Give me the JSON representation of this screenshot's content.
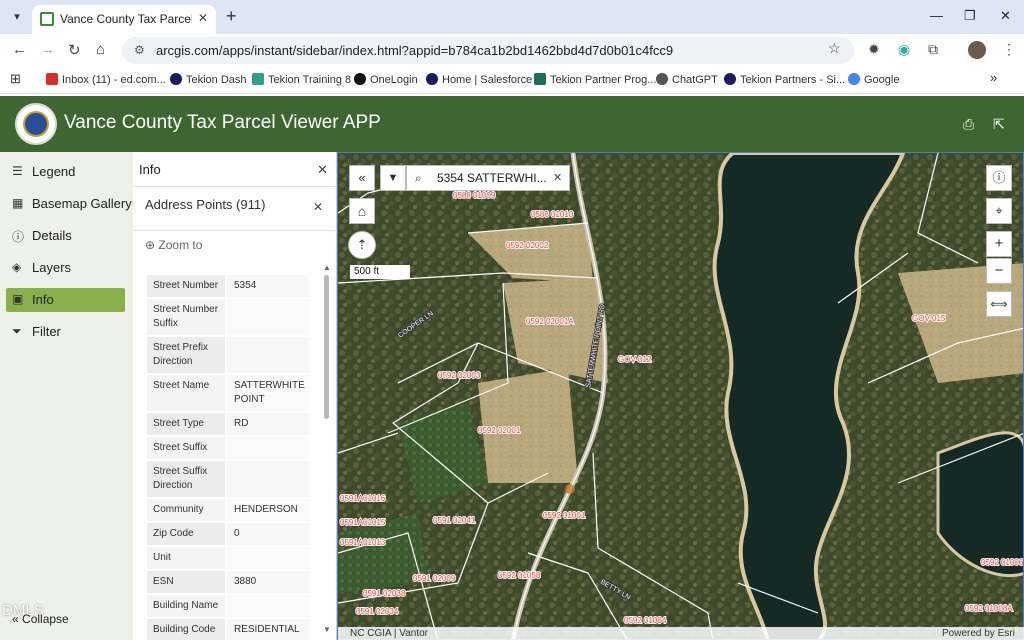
{
  "browser": {
    "tab_title": "Vance County Tax Parcel Viewer",
    "url": "arcgis.com/apps/instant/sidebar/index.html?appid=b784ca1b2bd1462bbd4d7d0b01c4fcc9",
    "bookmarks": [
      {
        "label": "Inbox (11) - ed.com...",
        "color": "#d93025"
      },
      {
        "label": "Tekion Dash",
        "color": "#1a1a5e"
      },
      {
        "label": "Tekion Training 8",
        "color": "#2e9e8f"
      },
      {
        "label": "OneLogin",
        "color": "#111111"
      },
      {
        "label": "Home | Salesforce",
        "color": "#1a1a5e"
      },
      {
        "label": "Tekion Partner Prog...",
        "color": "#1b6e5a"
      },
      {
        "label": "ChatGPT",
        "color": "#555555"
      },
      {
        "label": "Tekion Partners - Si...",
        "color": "#1a1a5e"
      },
      {
        "label": "Google",
        "color": "#4285f4"
      }
    ]
  },
  "app": {
    "title": "Vance County Tax Parcel Viewer APP",
    "header_color": "#3f6631"
  },
  "leftnav": {
    "items": [
      {
        "label": "Legend",
        "icon": "list-icon"
      },
      {
        "label": "Basemap Gallery",
        "icon": "grid-icon"
      },
      {
        "label": "Details",
        "icon": "info-icon"
      },
      {
        "label": "Layers",
        "icon": "layers-icon"
      },
      {
        "label": "Info",
        "icon": "info-square-icon",
        "active": true
      },
      {
        "label": "Filter",
        "icon": "filter-icon"
      }
    ],
    "collapse_label": "Collapse",
    "active_color": "#88b04b"
  },
  "watermark": "DMLS",
  "info": {
    "title": "Info",
    "layer_title": "Address Points (911)",
    "zoom_to": "Zoom to",
    "attributes": [
      {
        "key": "Street Number",
        "value": "5354"
      },
      {
        "key": "Street Number Suffix",
        "value": ""
      },
      {
        "key": "Street Prefix Direction",
        "value": ""
      },
      {
        "key": "Street Name",
        "value": "SATTERWHITE POINT"
      },
      {
        "key": "Street Type",
        "value": "RD"
      },
      {
        "key": "Street Suffix",
        "value": ""
      },
      {
        "key": "Street Suffix Direction",
        "value": ""
      },
      {
        "key": "Community",
        "value": "HENDERSON"
      },
      {
        "key": "Zip Code",
        "value": "0"
      },
      {
        "key": "Unit",
        "value": ""
      },
      {
        "key": "ESN",
        "value": "3880"
      },
      {
        "key": "Building Name",
        "value": ""
      },
      {
        "key": "Building Code",
        "value": "RESIDENTIAL"
      }
    ]
  },
  "map": {
    "search_text": "5354 SATTERWHI...",
    "scale_label": "500 ft",
    "attribution_left": "NC CGIA | Vantor",
    "attribution_right": "Powered by Esri",
    "parcel_labels": {
      "p1": "0588 01009",
      "p2": "0588 01010",
      "p3": "0592 02002",
      "p4": "0592 02001A",
      "p5": "GOV-012",
      "p6": "0592 02003",
      "p7": "0592 02001",
      "p8": "0591A01016",
      "p9": "0591 02041",
      "p10": "0592 01001",
      "p11": "0591A01015",
      "p12": "0591A01013",
      "p13": "0591 02009",
      "p14": "0592 01058",
      "p15": "0591 02038",
      "p16": "0591 02034",
      "p17": "0592 01084",
      "p18": "GOV-015",
      "p19": "0592 01006",
      "p20": "0592 01008A"
    },
    "road_labels": {
      "r1": "SATTERWHITE POINT RD",
      "r2": "COOPER LN",
      "r3": "BETTY LN"
    }
  }
}
